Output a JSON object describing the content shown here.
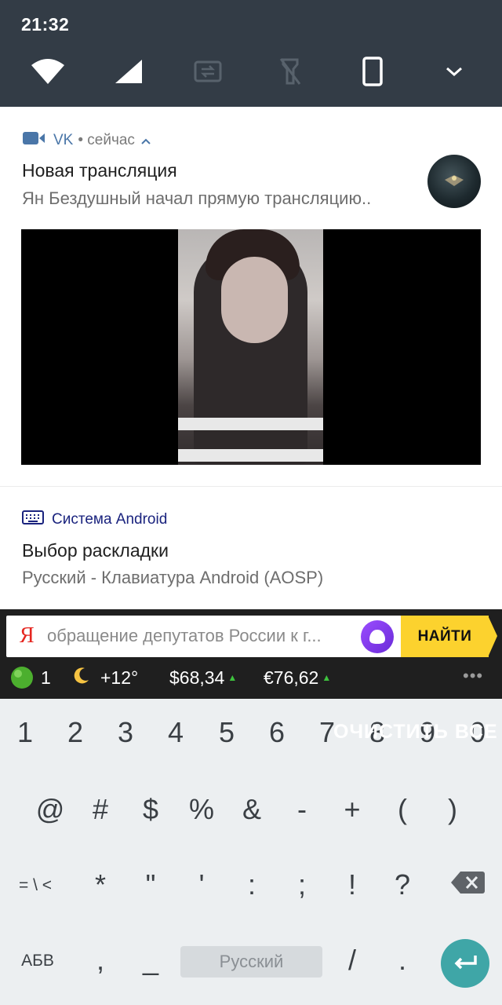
{
  "status": {
    "time": "21:32"
  },
  "quick_settings": {
    "icons": [
      "wifi-icon",
      "signal-icon",
      "data-sync-icon",
      "flashlight-icon",
      "phone-icon",
      "chevron-down-icon"
    ]
  },
  "notifications": [
    {
      "app": "VK",
      "time": "• сейчас",
      "title": "Новая трансляция",
      "text": "Ян Бездушный начал прямую трансляцию..",
      "accent": "#4a76a8"
    },
    {
      "app": "Система Android",
      "title": "Выбор раскладки",
      "text": "Русский - Клавиатура Android (AOSP)",
      "accent": "#1a237e"
    }
  ],
  "yandex": {
    "logo": "Я",
    "query": "обращение депутатов России к г...",
    "find_label": "НАЙТИ",
    "traffic_score": "1",
    "weather": "+12°",
    "usd": "$68,34",
    "eur": "€76,62",
    "more": "•••"
  },
  "keyboard": {
    "row1": [
      "1",
      "2",
      "3",
      "4",
      "5",
      "6",
      "7",
      "8",
      "9",
      "0"
    ],
    "row2": [
      "@",
      "#",
      "$",
      "%",
      "&",
      "-",
      "+",
      "(",
      ")"
    ],
    "row3": [
      "= \\ <",
      "*",
      "\"",
      "'",
      ":",
      ";",
      "!",
      "?"
    ],
    "row4": [
      "АБВ",
      ",",
      "_",
      "/",
      "."
    ],
    "space_label": "Русский",
    "clear_all_overlay": "ОЧИСТИТЬ ВСЕ"
  }
}
